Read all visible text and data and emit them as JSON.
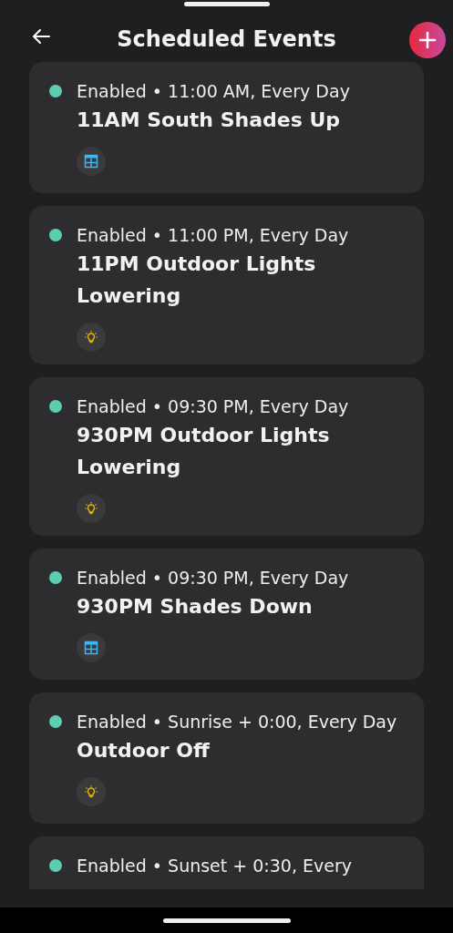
{
  "header": {
    "title": "Scheduled Events"
  },
  "events": [
    {
      "enabled": true,
      "status": "Enabled • 11:00 AM, Every Day",
      "name": "11AM South Shades Up",
      "icon": {
        "kind": "shade"
      }
    },
    {
      "enabled": true,
      "status": "Enabled • 11:00 PM, Every Day",
      "name": "11PM Outdoor Lights Lowering",
      "icon": {
        "kind": "light"
      }
    },
    {
      "enabled": true,
      "status": "Enabled • 09:30 PM, Every Day",
      "name": "930PM Outdoor Lights Lowering",
      "icon": {
        "kind": "light"
      }
    },
    {
      "enabled": true,
      "status": "Enabled • 09:30 PM, Every Day",
      "name": "930PM Shades Down",
      "icon": {
        "kind": "shade"
      }
    },
    {
      "enabled": true,
      "status": "Enabled • Sunrise + 0:00, Every Day",
      "name": "Outdoor Off",
      "icon": {
        "kind": "light"
      }
    },
    {
      "enabled": true,
      "status": "Enabled • Sunset + 0:30, Every"
    }
  ]
}
